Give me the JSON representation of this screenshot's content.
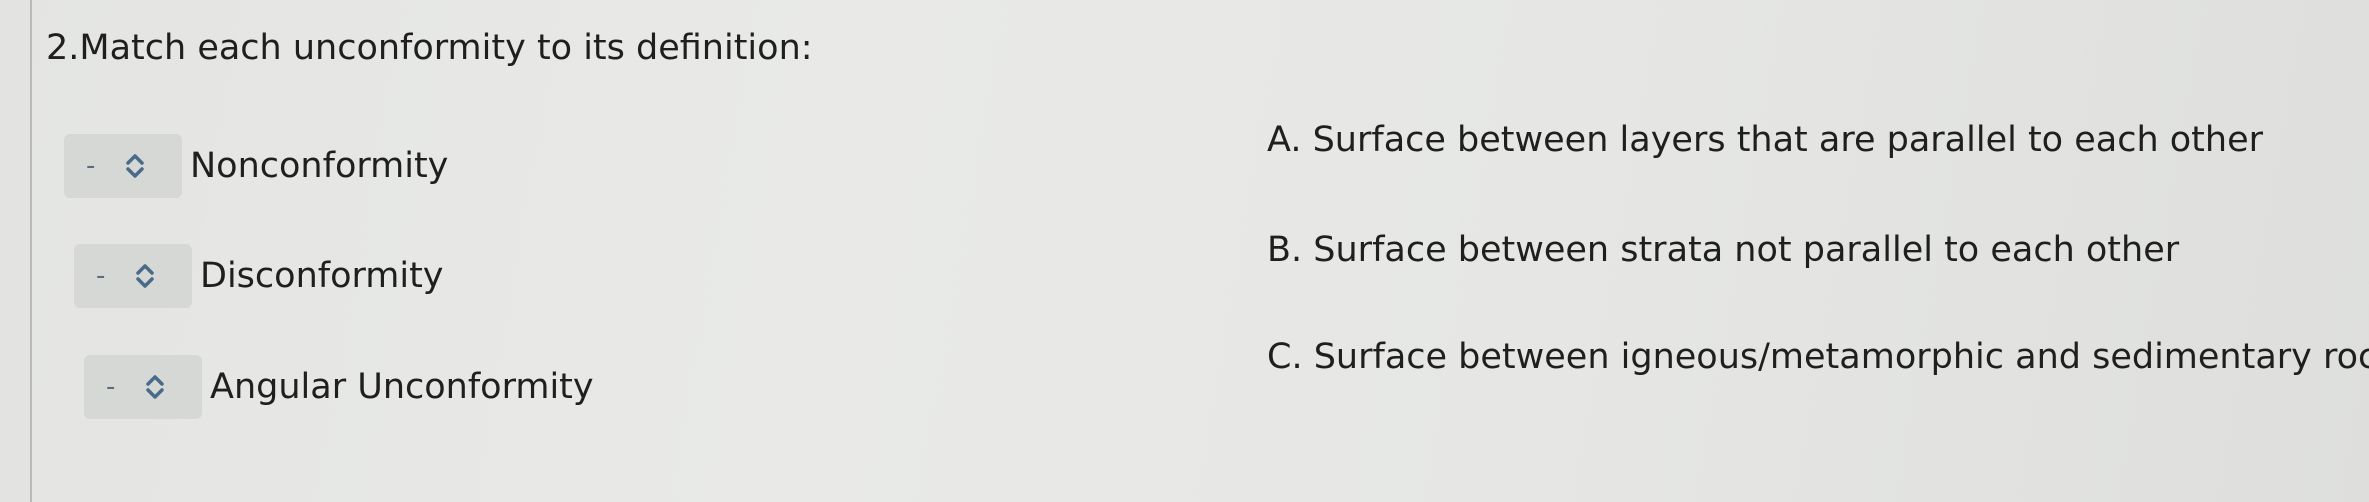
{
  "question": {
    "text": "2.Match each unconformity to its definition:"
  },
  "items": [
    {
      "select_value": "-",
      "term": "Nonconformity"
    },
    {
      "select_value": "-",
      "term": "Disconformity"
    },
    {
      "select_value": "-",
      "term": "Angular Unconformity"
    }
  ],
  "definitions": [
    {
      "letter": "A.",
      "text": "Surface between layers that are parallel to each other"
    },
    {
      "letter": "B.",
      "text": "Surface between strata not parallel to each other"
    },
    {
      "letter": "C.",
      "text": "Surface between igneous/metamorphic and sedimentary rocks"
    }
  ],
  "icons": {
    "select_toggle": "chevron-up-down-icon"
  },
  "colors": {
    "background": "#e7e8e6",
    "select_fill": "#d6d8d5",
    "dash": "#5b6d7a",
    "chevron": "#4a6a8a",
    "text": "#1f1f1f"
  }
}
